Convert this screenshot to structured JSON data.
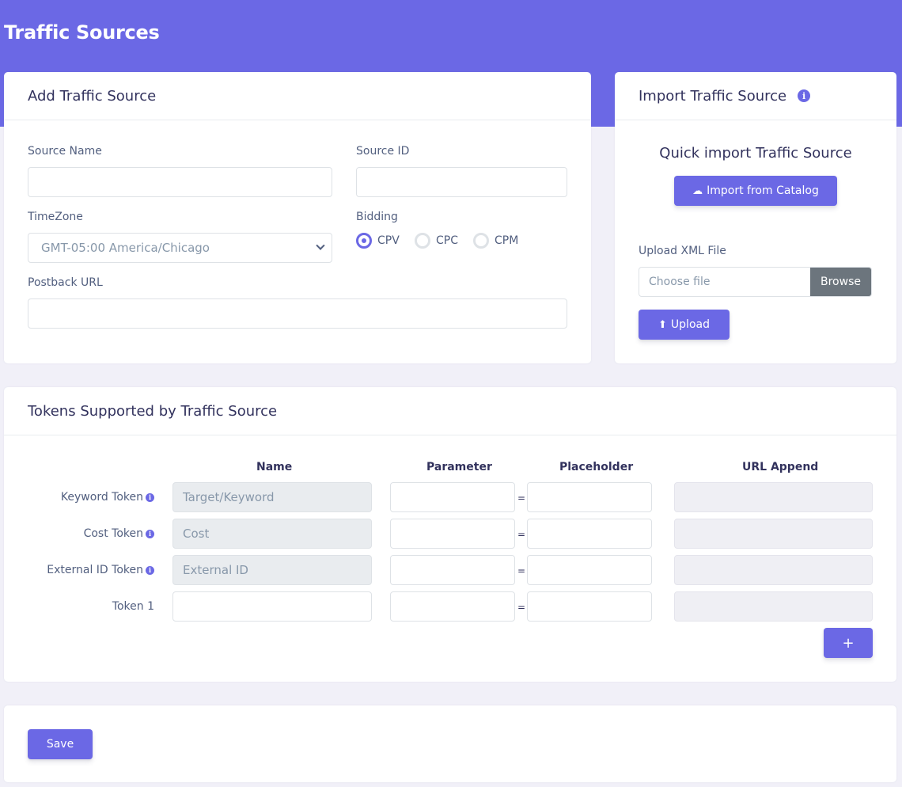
{
  "page": {
    "title": "Traffic Sources"
  },
  "add_card": {
    "header": "Add Traffic Source",
    "source_name_label": "Source Name",
    "source_id_label": "Source ID",
    "timezone_label": "TimeZone",
    "timezone_value": "GMT-05:00 America/Chicago",
    "bidding_label": "Bidding",
    "bidding_options": [
      "CPV",
      "CPC",
      "CPM"
    ],
    "bidding_selected": "CPV",
    "postback_label": "Postback URL"
  },
  "import_card": {
    "header": "Import Traffic Source",
    "quick_title": "Quick import Traffic Source",
    "catalog_button": "Import from Catalog",
    "upload_label": "Upload XML File",
    "file_placeholder": "Choose file",
    "browse_button": "Browse",
    "upload_button": "Upload"
  },
  "tokens_card": {
    "header": "Tokens Supported by Traffic Source",
    "columns": [
      "Name",
      "Parameter",
      "Placeholder",
      "URL Append"
    ],
    "rows": [
      {
        "label": "Keyword Token",
        "name_placeholder": "Target/Keyword",
        "info": true
      },
      {
        "label": "Cost Token",
        "name_placeholder": "Cost",
        "info": true
      },
      {
        "label": "External ID Token",
        "name_placeholder": "External ID",
        "info": true
      },
      {
        "label": "Token 1",
        "name_placeholder": "",
        "info": false
      }
    ],
    "equals": "=",
    "add_button": "+"
  },
  "save_card": {
    "save_button": "Save"
  },
  "colors": {
    "accent": "#6b68e5",
    "browse": "#6c757d"
  }
}
